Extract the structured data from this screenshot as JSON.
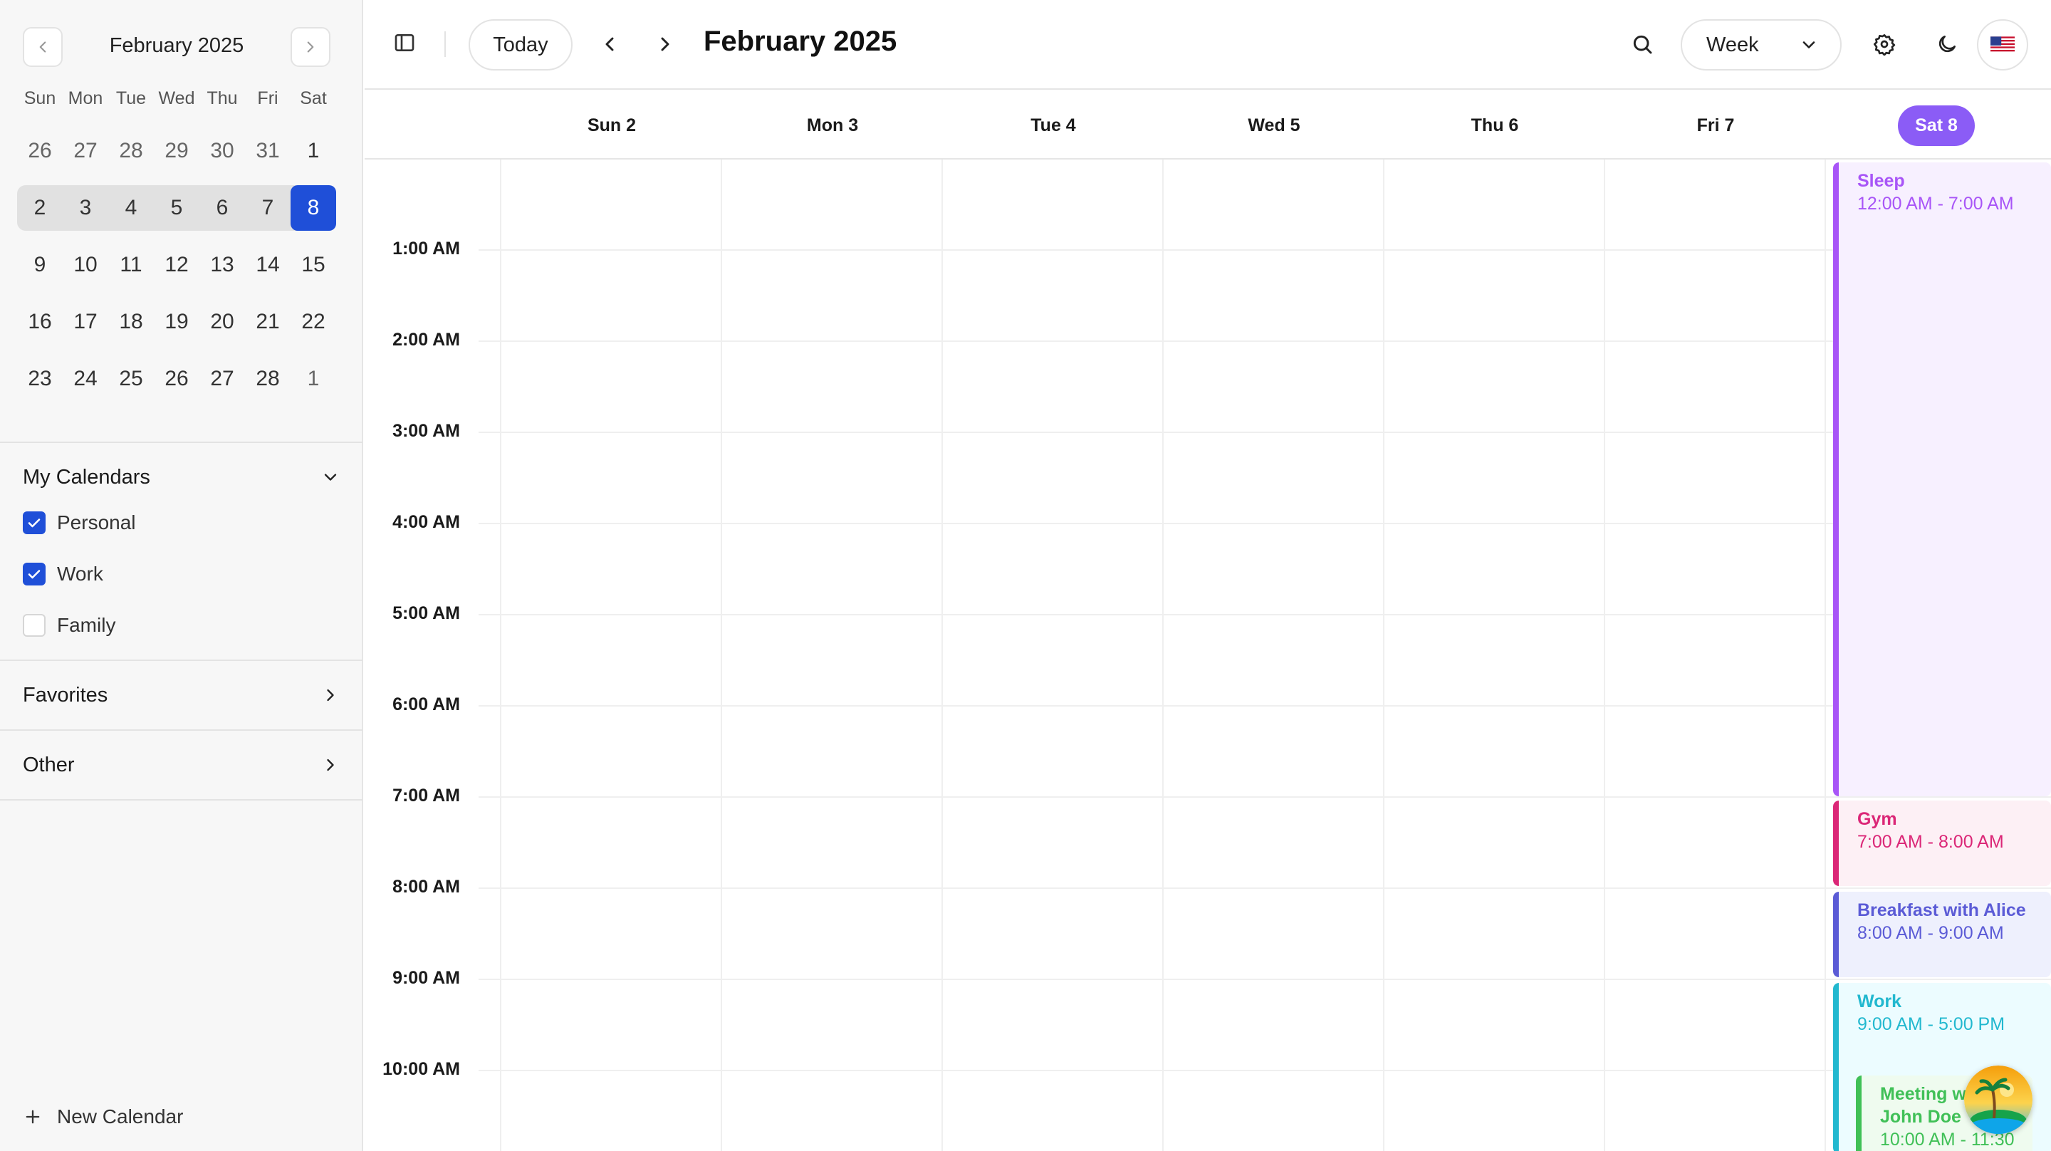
{
  "mini_calendar": {
    "title": "February 2025",
    "dow": [
      "Sun",
      "Mon",
      "Tue",
      "Wed",
      "Thu",
      "Fri",
      "Sat"
    ],
    "weeks": [
      [
        "26",
        "27",
        "28",
        "29",
        "30",
        "31",
        "1"
      ],
      [
        "2",
        "3",
        "4",
        "5",
        "6",
        "7",
        "8"
      ],
      [
        "9",
        "10",
        "11",
        "12",
        "13",
        "14",
        "15"
      ],
      [
        "16",
        "17",
        "18",
        "19",
        "20",
        "21",
        "22"
      ],
      [
        "23",
        "24",
        "25",
        "26",
        "27",
        "28",
        "1"
      ]
    ],
    "selected_day": "8"
  },
  "sidebar": {
    "my_calendars": "My Calendars",
    "calendars": [
      {
        "label": "Personal",
        "checked": true
      },
      {
        "label": "Work",
        "checked": true
      },
      {
        "label": "Family",
        "checked": false
      }
    ],
    "favorites": "Favorites",
    "other": "Other",
    "new_calendar": "New Calendar"
  },
  "toolbar": {
    "today": "Today",
    "title": "February 2025",
    "view": "Week"
  },
  "days": [
    "Sun 2",
    "Mon 3",
    "Tue 4",
    "Wed 5",
    "Thu 6",
    "Fri 7",
    "Sat 8"
  ],
  "hours": [
    "1:00 AM",
    "2:00 AM",
    "3:00 AM",
    "4:00 AM",
    "5:00 AM",
    "6:00 AM",
    "7:00 AM",
    "8:00 AM",
    "9:00 AM",
    "10:00 AM"
  ],
  "events": [
    {
      "title": "Sleep",
      "time": "12:00 AM - 7:00 AM",
      "color": "#a855f7",
      "bg": "#f7f0ff"
    },
    {
      "title": "Gym",
      "time": "7:00 AM - 8:00 AM",
      "color": "#db2777",
      "bg": "#fdf0f5"
    },
    {
      "title": "Breakfast with Alice",
      "time": "8:00 AM - 9:00 AM",
      "color": "#5b5bd6",
      "bg": "#eef0fd"
    },
    {
      "title": "Work",
      "time": "9:00 AM - 5:00 PM",
      "color": "#22b8cf",
      "bg": "#ecfcff"
    },
    {
      "title": "Meeting with John Doe",
      "time": "10:00 AM - 11:30",
      "color": "#40c057",
      "bg": "#effbef"
    }
  ],
  "colors": {
    "accent": "#1f4fd8",
    "today_pill": "#8b5cf6"
  }
}
